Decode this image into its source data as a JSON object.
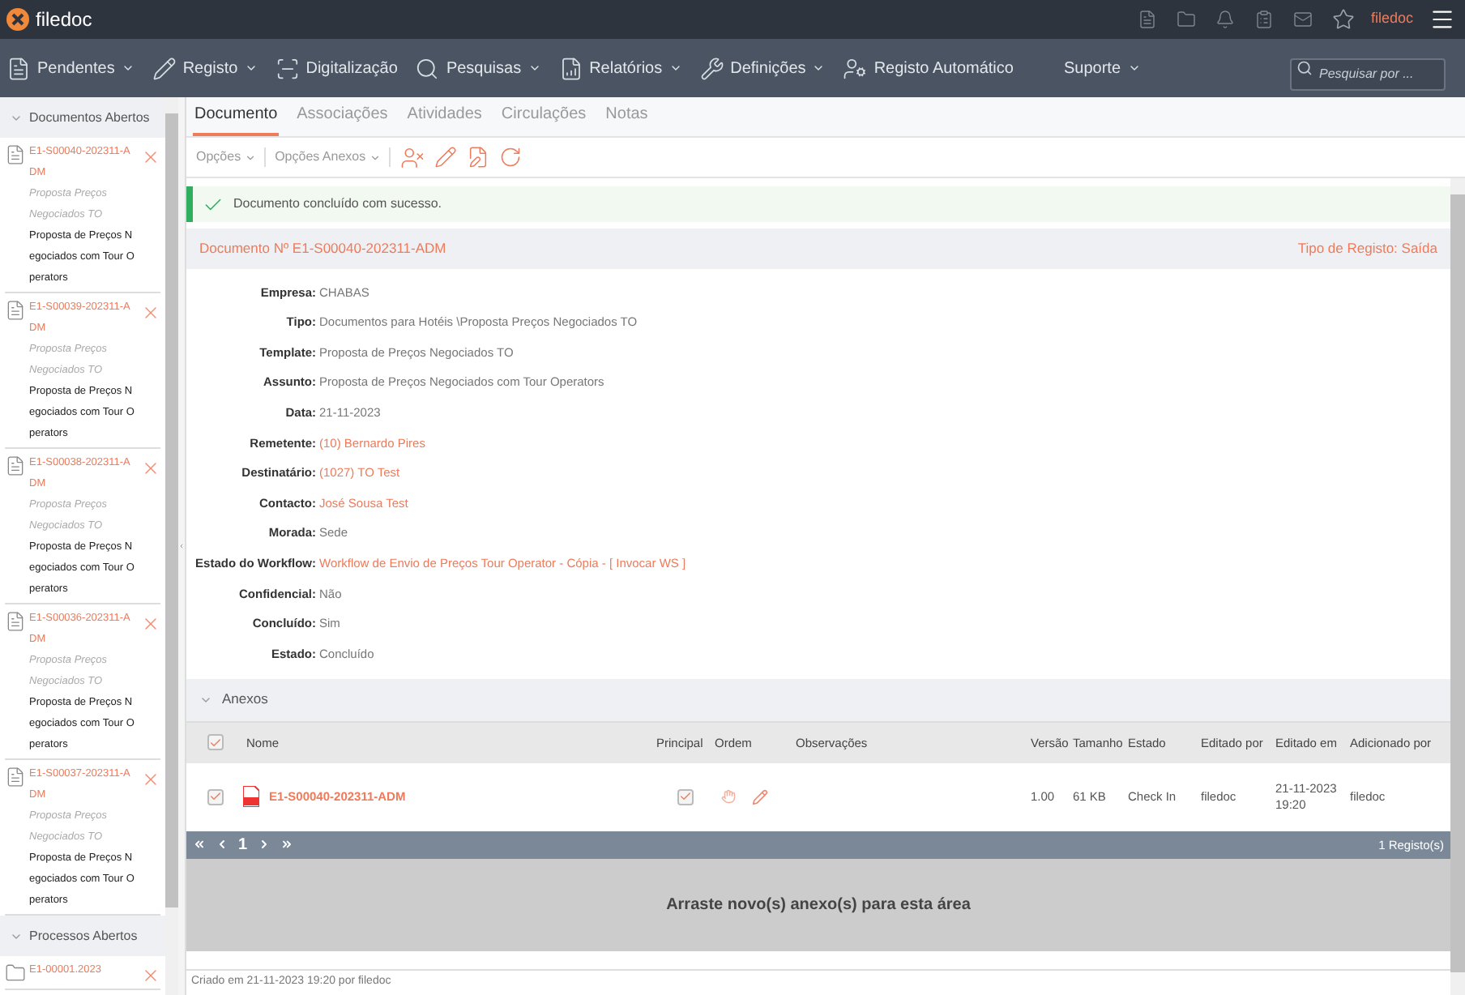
{
  "app": {
    "name": "filedoc",
    "user": "filedoc"
  },
  "nav": [
    {
      "label": "Pendentes",
      "dropdown": true
    },
    {
      "label": "Registo",
      "dropdown": true
    },
    {
      "label": "Digitalização",
      "dropdown": false
    },
    {
      "label": "Pesquisas",
      "dropdown": true
    },
    {
      "label": "Relatórios",
      "dropdown": true
    },
    {
      "label": "Definições",
      "dropdown": true
    },
    {
      "label": "Registo Automático",
      "dropdown": false
    },
    {
      "label": "Suporte",
      "dropdown": true
    }
  ],
  "search": {
    "placeholder": "Pesquisar por ..."
  },
  "sidebar": {
    "sections": [
      {
        "title": "Documentos Abertos",
        "expanded": true,
        "items": [
          {
            "kind": "document",
            "code": "E1-S00040-202311-ADM",
            "type": "Proposta Preços Negociados TO",
            "subject": "Proposta de Preços Negociados com Tour Operators"
          },
          {
            "kind": "document",
            "code": "E1-S00039-202311-ADM",
            "type": "Proposta Preços Negociados TO",
            "subject": "Proposta de Preços Negociados com Tour Operators"
          },
          {
            "kind": "document",
            "code": "E1-S00038-202311-ADM",
            "type": "Proposta Preços Negociados TO",
            "subject": "Proposta de Preços Negociados com Tour Operators"
          },
          {
            "kind": "document",
            "code": "E1-S00036-202311-ADM",
            "type": "Proposta Preços Negociados TO",
            "subject": "Proposta de Preços Negociados com Tour Operators"
          },
          {
            "kind": "document",
            "code": "E1-S00037-202311-ADM",
            "type": "Proposta Preços Negociados TO",
            "subject": "Proposta de Preços Negociados com Tour Operators"
          }
        ]
      },
      {
        "title": "Processos Abertos",
        "expanded": true,
        "items": [
          {
            "kind": "process",
            "code": "E1-00001.2023"
          }
        ]
      }
    ]
  },
  "tabs": [
    {
      "label": "Documento",
      "selected": true
    },
    {
      "label": "Associações",
      "selected": false
    },
    {
      "label": "Atividades",
      "selected": false
    },
    {
      "label": "Circulações",
      "selected": false
    },
    {
      "label": "Notas",
      "selected": false
    }
  ],
  "toolbar": {
    "menus": [
      "Opções",
      "Opções Anexos"
    ]
  },
  "alert": {
    "message": "Documento concluído com sucesso."
  },
  "document": {
    "title": "Documento Nº E1-S00040-202311-ADM",
    "register_type": "Tipo de Registo: Saída",
    "fields": [
      {
        "label": "Empresa:",
        "value": "CHABAS",
        "kind": "text"
      },
      {
        "label": "Tipo:",
        "value": "Documentos para Hotéis \\Proposta Preços Negociados TO",
        "kind": "text"
      },
      {
        "label": "Template:",
        "value": "Proposta de Preços Negociados TO",
        "kind": "text"
      },
      {
        "label": "Assunto:",
        "value": "Proposta de Preços Negociados com Tour Operators",
        "kind": "text"
      },
      {
        "label": "Data:",
        "value": "21-11-2023",
        "kind": "text"
      },
      {
        "label": "Remetente:",
        "value": "(10) Bernardo Pires",
        "kind": "link"
      },
      {
        "label": "Destinatário:",
        "value": "(1027) TO Test",
        "kind": "link"
      },
      {
        "label": "Contacto:",
        "value": "José Sousa Test",
        "kind": "link"
      },
      {
        "label": "Morada:",
        "value": "Sede",
        "kind": "text"
      },
      {
        "label": "Estado do Workflow:",
        "value": "Workflow de Envio de Preços Tour Operator - Cópia - [ Invocar WS ]",
        "kind": "link"
      },
      {
        "label": "Confidencial:",
        "value": "Não",
        "kind": "text"
      },
      {
        "label": "Concluído:",
        "value": "Sim",
        "kind": "text"
      },
      {
        "label": "Estado:",
        "value": "Concluído",
        "kind": "text"
      }
    ]
  },
  "attachments": {
    "title": "Anexos",
    "expanded": true,
    "all_checked": true,
    "columns": [
      "Nome",
      "Principal",
      "Ordem",
      "Observações",
      "Versão",
      "Tamanho",
      "Estado",
      "Editado por",
      "Editado em",
      "Adicionado por"
    ],
    "rows": [
      {
        "checked": true,
        "name": "E1-S00040-202311-ADM",
        "principal": true,
        "version": "1.00",
        "size": "61 KB",
        "state": "Check In",
        "edited_by": "filedoc",
        "edited_at": "21-11-2023 19:20",
        "added_by": "filedoc"
      }
    ],
    "page": "1",
    "count": "1 Registo(s)",
    "drop_text": "Arraste novo(s) anexo(s) para esta área"
  },
  "footer": "Criado em 21-11-2023 19:20 por filedoc"
}
